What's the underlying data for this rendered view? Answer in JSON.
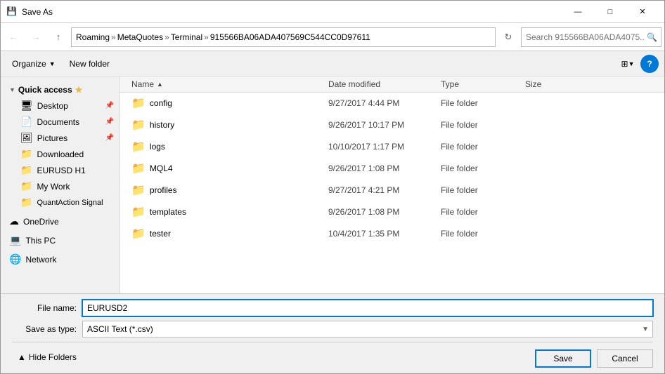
{
  "window": {
    "title": "Save As",
    "icon": "💾"
  },
  "titlebar": {
    "controls": {
      "minimize": "—",
      "maximize": "□",
      "close": "✕"
    }
  },
  "addressbar": {
    "back_label": "←",
    "forward_label": "→",
    "up_label": "↑",
    "path": {
      "parts": [
        "Roaming",
        "MetaQuotes",
        "Terminal",
        "915566BA06ADA407569C544CC0D97611"
      ]
    },
    "refresh_label": "⟳",
    "search_placeholder": "Search 915566BA06ADA4075..."
  },
  "toolbar": {
    "organize_label": "Organize",
    "new_folder_label": "New folder",
    "view_label": "⊞",
    "help_label": "?"
  },
  "sidebar": {
    "quick_access_label": "Quick access",
    "items_quick": [
      {
        "id": "desktop",
        "label": "Desktop",
        "pinned": true,
        "icon": "🖥"
      },
      {
        "id": "documents",
        "label": "Documents",
        "pinned": true,
        "icon": "📄"
      },
      {
        "id": "pictures",
        "label": "Pictures",
        "pinned": true,
        "icon": "🖼"
      },
      {
        "id": "downloaded",
        "label": "Downloaded",
        "pinned": false,
        "icon": "📁"
      },
      {
        "id": "eurusd-h1",
        "label": "EURUSD H1",
        "pinned": false,
        "icon": "📁"
      },
      {
        "id": "my-work",
        "label": "My Work",
        "pinned": false,
        "icon": "📁"
      },
      {
        "id": "quantaction",
        "label": "QuantAction Signal",
        "pinned": false,
        "icon": "📁"
      }
    ],
    "onedrive_label": "OneDrive",
    "thispc_label": "This PC",
    "network_label": "Network",
    "hide_folders_label": "Hide Folders"
  },
  "file_list": {
    "columns": [
      {
        "id": "name",
        "label": "Name",
        "sort_arrow": "▲"
      },
      {
        "id": "date",
        "label": "Date modified"
      },
      {
        "id": "type",
        "label": "Type"
      },
      {
        "id": "size",
        "label": "Size"
      }
    ],
    "rows": [
      {
        "name": "config",
        "date": "9/27/2017 4:44 PM",
        "type": "File folder",
        "size": ""
      },
      {
        "name": "history",
        "date": "9/26/2017 10:17 PM",
        "type": "File folder",
        "size": ""
      },
      {
        "name": "logs",
        "date": "10/10/2017 1:17 PM",
        "type": "File folder",
        "size": ""
      },
      {
        "name": "MQL4",
        "date": "9/26/2017 1:08 PM",
        "type": "File folder",
        "size": ""
      },
      {
        "name": "profiles",
        "date": "9/27/2017 4:21 PM",
        "type": "File folder",
        "size": ""
      },
      {
        "name": "templates",
        "date": "9/26/2017 1:08 PM",
        "type": "File folder",
        "size": ""
      },
      {
        "name": "tester",
        "date": "10/4/2017 1:35 PM",
        "type": "File folder",
        "size": ""
      }
    ]
  },
  "form": {
    "filename_label": "File name:",
    "filename_value": "EURUSD2",
    "savetype_label": "Save as type:",
    "savetype_value": "ASCII Text (*.csv)",
    "savetype_options": [
      "ASCII Text (*.csv)"
    ],
    "save_button": "Save",
    "cancel_button": "Cancel",
    "hide_folders_label": "Hide Folders",
    "hide_icon": "▲"
  }
}
